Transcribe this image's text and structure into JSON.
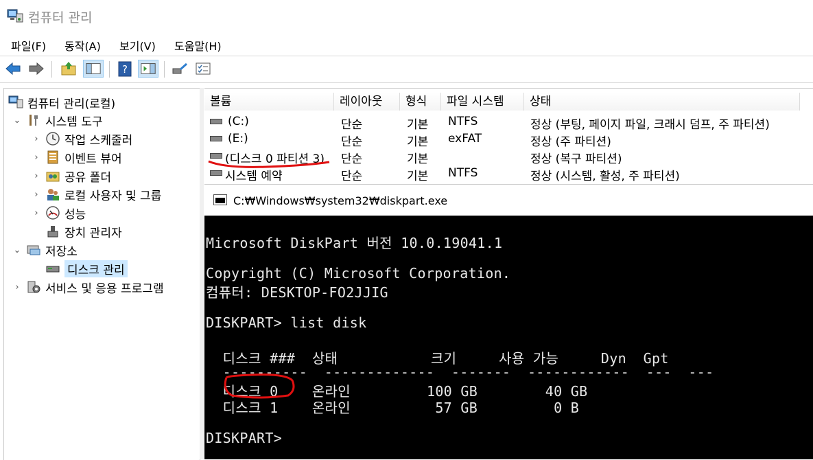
{
  "window": {
    "title": "컴퓨터 관리"
  },
  "menu": [
    "파일(F)",
    "동작(A)",
    "보기(V)",
    "도움말(H)"
  ],
  "toolbar": {
    "icons": [
      "back-icon",
      "forward-icon",
      "up-folder-icon",
      "show-hide-tree-icon",
      "help-icon",
      "action-pane-icon",
      "connect-icon",
      "properties-icon"
    ]
  },
  "tree": {
    "root": "컴퓨터 관리(로컬)",
    "system_tools": "시스템 도구",
    "task_scheduler": "작업 스케줄러",
    "event_viewer": "이벤트 뷰어",
    "shared_folders": "공유 폴더",
    "local_users": "로컬 사용자 및 그룹",
    "performance": "성능",
    "device_manager": "장치 관리자",
    "storage": "저장소",
    "disk_management": "디스크 관리",
    "services": "서비스 및 응용 프로그램"
  },
  "volumes": {
    "headers": [
      "볼륨",
      "레이아웃",
      "형식",
      "파일 시스템",
      "상태"
    ],
    "rows": [
      [
        "(C:)",
        "단순",
        "기본",
        "NTFS",
        "정상 (부팅, 페이지 파일, 크래시 덤프, 주 파티션)"
      ],
      [
        "(E:)",
        "단순",
        "기본",
        "exFAT",
        "정상 (주 파티션)"
      ],
      [
        "(디스크 0 파티션 3)",
        "단순",
        "기본",
        "",
        "정상 (복구 파티션)"
      ],
      [
        "시스템 예약",
        "단순",
        "기본",
        "NTFS",
        "정상 (시스템, 활성, 주 파티션)"
      ]
    ]
  },
  "console": {
    "title": "C:₩Windows₩system32₩diskpart.exe",
    "lines": [
      "Microsoft DiskPart 버전 10.0.19041.1",
      "",
      "Copyright (C) Microsoft Corporation.",
      "컴퓨터: DESKTOP-FO2JJIG",
      "",
      "DISKPART> list disk",
      "",
      "  디스크 ###  상태           크기     사용 가능     Dyn  Gpt",
      "  ----------  -------------  -------  ------------  ---  ---",
      "  디스크 0    온라인         100 GB        40 GB",
      "  디스크 1    온라인          57 GB         0 B",
      "",
      "DISKPART> "
    ]
  },
  "colors": {
    "annotation": "#e01010",
    "selection": "#cce8ff",
    "console_bg": "#000000",
    "console_fg": "#e8e8e8"
  }
}
